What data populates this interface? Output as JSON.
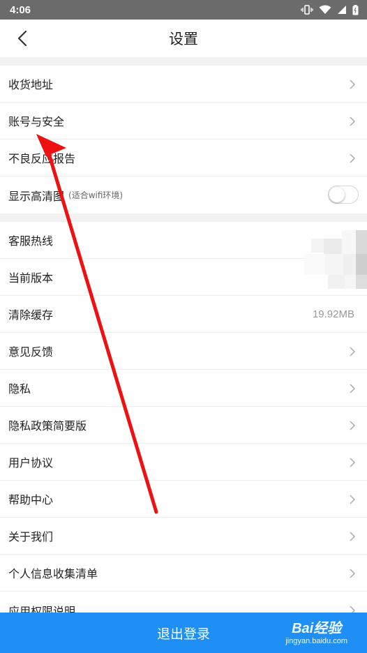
{
  "status_bar": {
    "time": "4:06"
  },
  "header": {
    "title": "设置"
  },
  "group1": [
    {
      "label": "收货地址"
    },
    {
      "label": "账号与安全"
    },
    {
      "label": "不良反应报告"
    },
    {
      "label": "显示高清图",
      "sub": "(适合wifi环境)",
      "toggle": false
    }
  ],
  "group2": [
    {
      "label": "客服热线"
    },
    {
      "label": "当前版本"
    },
    {
      "label": "清除缓存",
      "value": "19.92MB"
    },
    {
      "label": "意见反馈"
    },
    {
      "label": "隐私"
    },
    {
      "label": "隐私政策简要版"
    },
    {
      "label": "用户协议"
    },
    {
      "label": "帮助中心"
    },
    {
      "label": "关于我们"
    },
    {
      "label": "个人信息收集清单"
    },
    {
      "label": "应用权限说明"
    }
  ],
  "footer": {
    "logout_label": "退出登录"
  },
  "watermark": {
    "brand": "Bai经验",
    "url": "jingyan.baidu.com"
  },
  "colors": {
    "accent": "#1e90f5",
    "arrow": "#ee1111"
  }
}
